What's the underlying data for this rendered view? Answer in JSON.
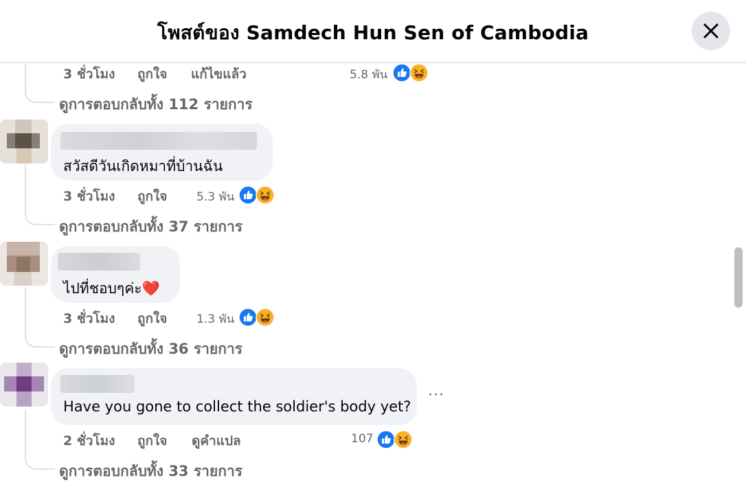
{
  "dialog": {
    "title": "โพสต์ของ Samdech Hun Sen of Cambodia"
  },
  "icons": {
    "close": "close-icon",
    "like": "like-reaction-icon",
    "haha": "haha-reaction-icon",
    "love": "red-heart-emoji"
  },
  "colors": {
    "like_blue": "#1877f2",
    "haha_yellow": "#f7b125",
    "secondary_text": "#65676b",
    "bubble_bg": "#f0f2f5"
  },
  "comments": [
    {
      "time": "3 ชั่วโมง",
      "like_label": "ถูกใจ",
      "extra_action": "แก้ไขแล้ว",
      "reaction_count": "5.8 พัน",
      "replies_label": "ดูการตอบกลับทั้ง 112 รายการ"
    },
    {
      "text": "สวัสดีวันเกิดหมาที่บ้านฉัน",
      "time": "3 ชั่วโมง",
      "like_label": "ถูกใจ",
      "reaction_count": "5.3 พัน",
      "replies_label": "ดูการตอบกลับทั้ง 37 รายการ"
    },
    {
      "text": "ไปที่ชอบๆค่ะ",
      "emoji": "❤️",
      "time": "3 ชั่วโมง",
      "like_label": "ถูกใจ",
      "reaction_count": "1.3 พัน",
      "replies_label": "ดูการตอบกลับทั้ง 36 รายการ"
    },
    {
      "text": "Have you gone to collect the soldier's body yet?",
      "time": "2 ชั่วโมง",
      "like_label": "ถูกใจ",
      "extra_action": "ดูคำแปล",
      "reaction_count": "107",
      "more_label": "···",
      "replies_label": "ดูการตอบกลับทั้ง 33 รายการ"
    }
  ]
}
